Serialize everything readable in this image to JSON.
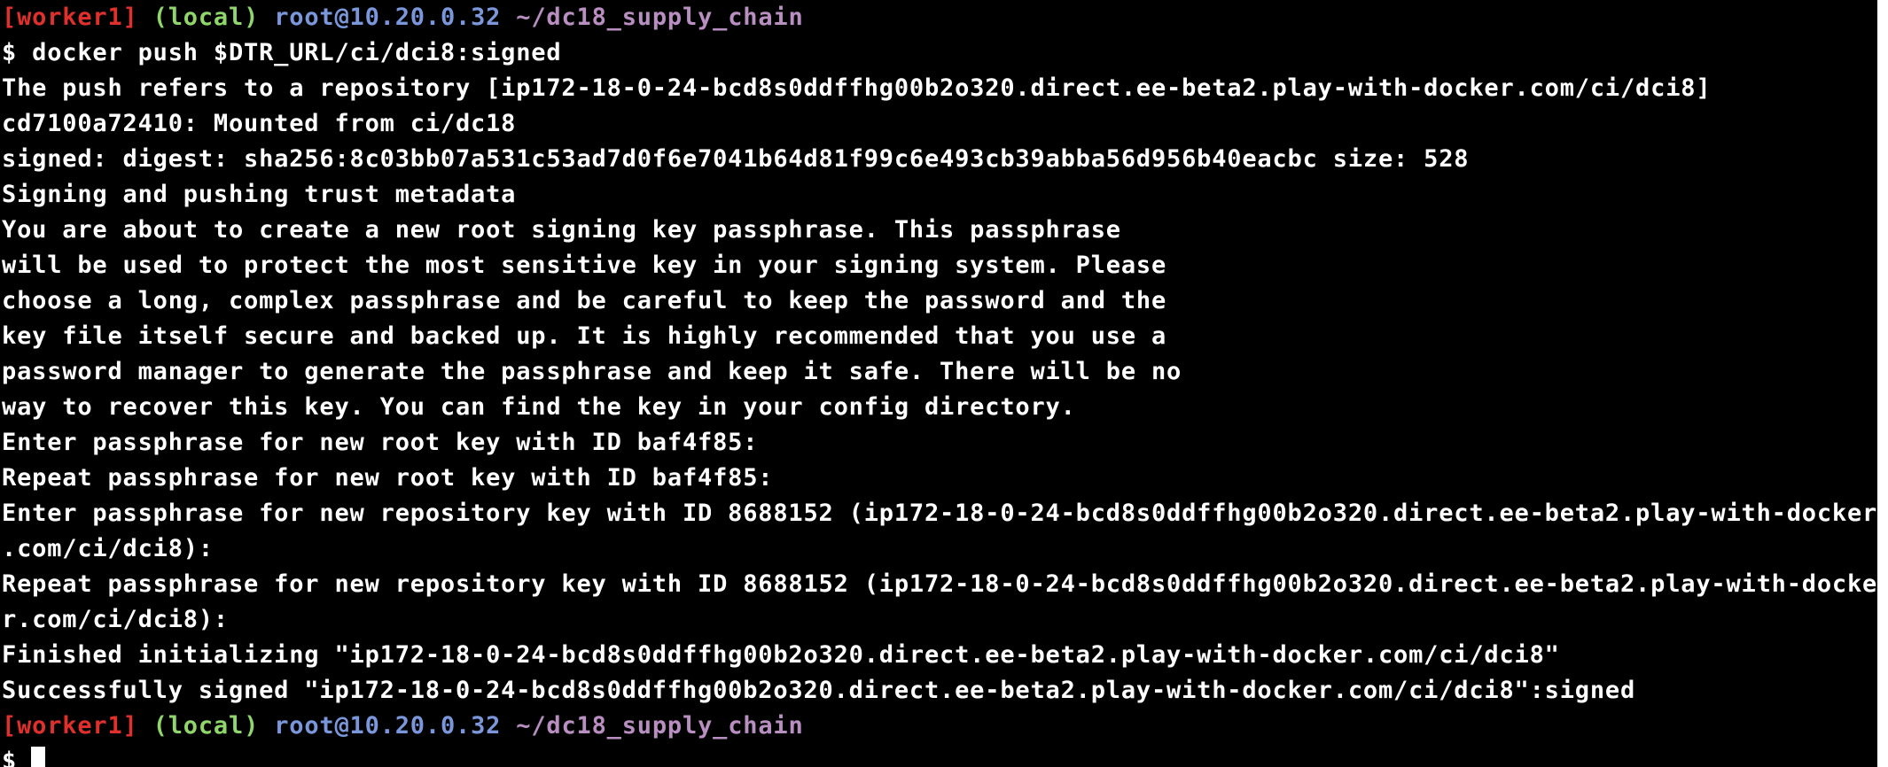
{
  "terminal": {
    "prompt": {
      "host_tag": "[worker1]",
      "env_tag": "(local)",
      "user_host": "root@10.20.0.32",
      "cwd": "~/dc18_supply_chain",
      "symbol": "$"
    },
    "command": "$ docker push $DTR_URL/ci/dci8:signed",
    "output": [
      "The push refers to a repository [ip172-18-0-24-bcd8s0ddffhg00b2o320.direct.ee-beta2.play-with-docker.com/ci/dci8]",
      "cd7100a72410: Mounted from ci/dc18",
      "signed: digest: sha256:8c03bb07a531c53ad7d0f6e7041b64d81f99c6e493cb39abba56d956b40eacbc size: 528",
      "Signing and pushing trust metadata",
      "You are about to create a new root signing key passphrase. This passphrase",
      "will be used to protect the most sensitive key in your signing system. Please",
      "choose a long, complex passphrase and be careful to keep the password and the",
      "key file itself secure and backed up. It is highly recommended that you use a",
      "password manager to generate the passphrase and keep it safe. There will be no",
      "way to recover this key. You can find the key in your config directory.",
      "Enter passphrase for new root key with ID baf4f85:",
      "Repeat passphrase for new root key with ID baf4f85:",
      "Enter passphrase for new repository key with ID 8688152 (ip172-18-0-24-bcd8s0ddffhg00b2o320.direct.ee-beta2.play-with-docker",
      ".com/ci/dci8):",
      "Repeat passphrase for new repository key with ID 8688152 (ip172-18-0-24-bcd8s0ddffhg00b2o320.direct.ee-beta2.play-with-docke",
      "r.com/ci/dci8):",
      "Finished initializing \"ip172-18-0-24-bcd8s0ddffhg00b2o320.direct.ee-beta2.play-with-docker.com/ci/dci8\"",
      "Successfully signed \"ip172-18-0-24-bcd8s0ddffhg00b2o320.direct.ee-beta2.play-with-docker.com/ci/dci8\":signed"
    ]
  },
  "colors": {
    "background": "#000000",
    "text": "#ffffff",
    "host_tag": "#e0302c",
    "env_tag": "#8fd66b",
    "user_host": "#7a97dc",
    "cwd": "#b98fc2"
  }
}
